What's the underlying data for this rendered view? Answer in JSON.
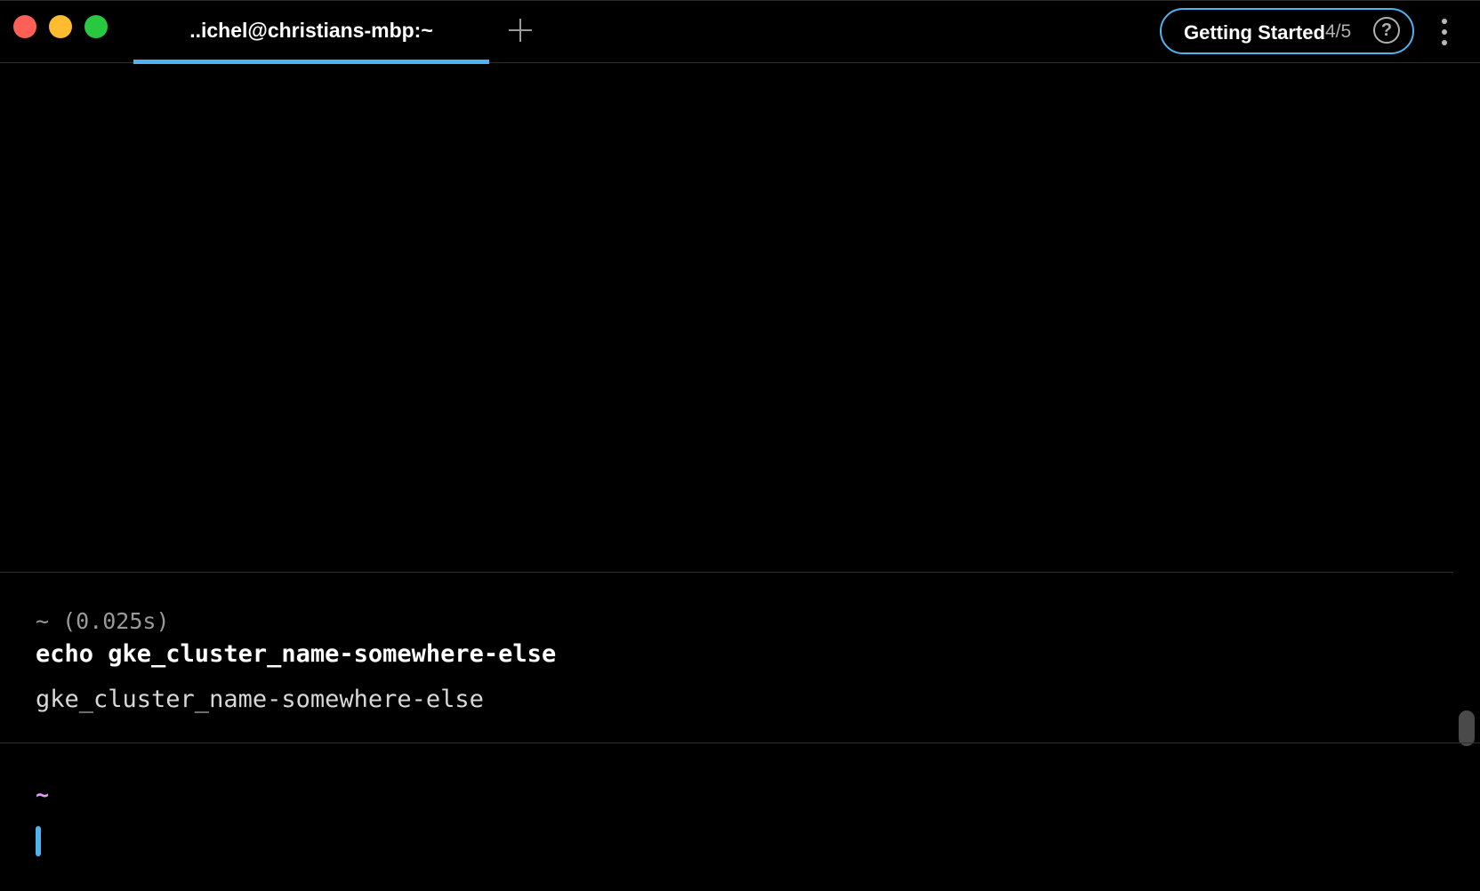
{
  "window": {
    "traffic_lights": {
      "close_color": "#fe5f57",
      "minimize_color": "#febc2e",
      "maximize_color": "#28c840"
    },
    "tabs": [
      {
        "label": "..ichel@christians-mbp:~",
        "active": true
      }
    ],
    "new_tab_icon": "plus-icon",
    "getting_started": {
      "label": "Getting Started",
      "progress": "4/5",
      "help_glyph": "?"
    },
    "menu_icon": "kebab-menu-icon",
    "accent_color": "#4fb3f0"
  },
  "terminal": {
    "block": {
      "meta": "~ (0.025s)",
      "command": "echo gke_cluster_name-somewhere-else",
      "output": "gke_cluster_name-somewhere-else"
    },
    "input": {
      "prompt": "~",
      "prompt_color": "#e59bf1",
      "value": ""
    }
  }
}
